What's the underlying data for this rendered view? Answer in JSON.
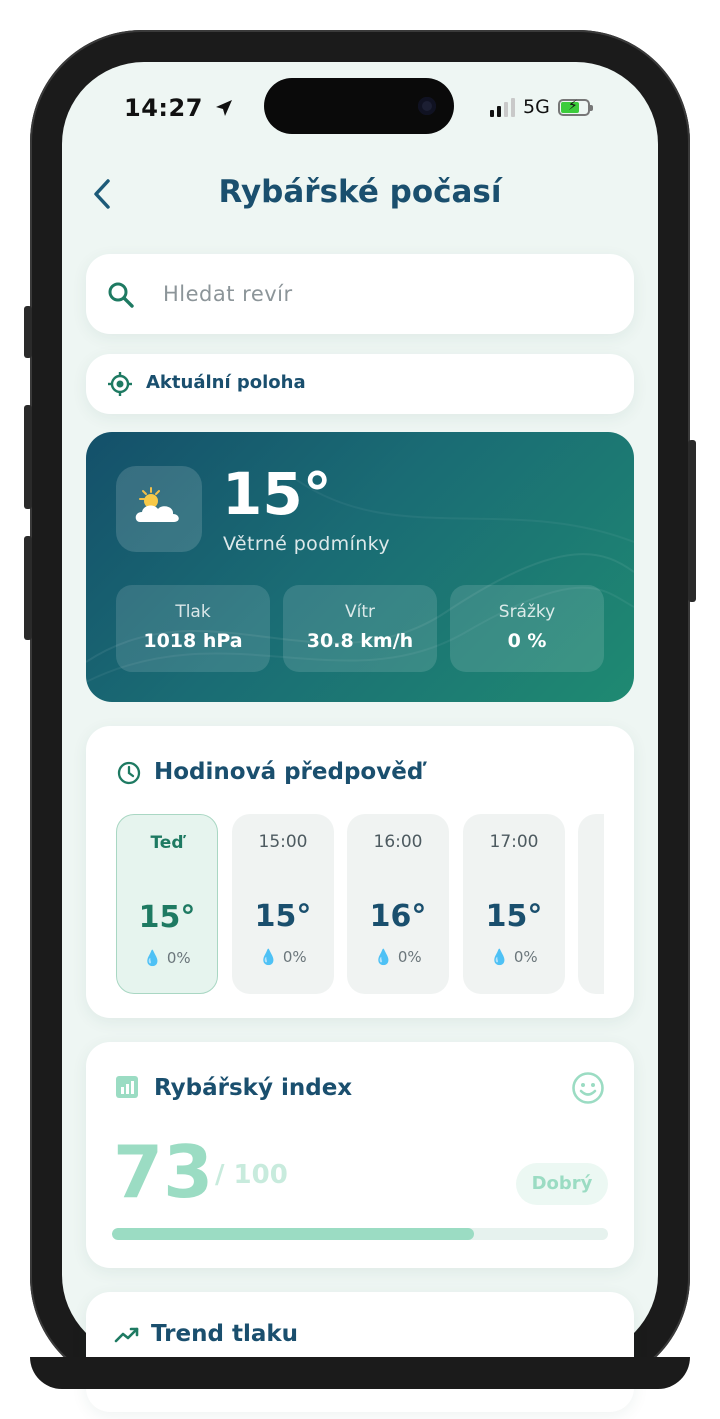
{
  "status_bar": {
    "time": "14:27",
    "network": "5G"
  },
  "header": {
    "back_label": "‹",
    "title": "Rybářské počasí"
  },
  "search": {
    "placeholder": "Hledat revír"
  },
  "location": {
    "label": "Aktuální poloha"
  },
  "current": {
    "icon": "partly-cloudy-icon",
    "temperature": "15°",
    "condition": "Větrné podmínky",
    "stats": [
      {
        "label": "Tlak",
        "value": "1018 hPa"
      },
      {
        "label": "Vítr",
        "value": "30.8 km/h"
      },
      {
        "label": "Srážky",
        "value": "0 %"
      }
    ]
  },
  "hourly": {
    "title": "Hodinová předpověď",
    "items": [
      {
        "time": "Teď",
        "temp": "15°",
        "rain": "0%"
      },
      {
        "time": "15:00",
        "temp": "15°",
        "rain": "0%"
      },
      {
        "time": "16:00",
        "temp": "16°",
        "rain": "0%"
      },
      {
        "time": "17:00",
        "temp": "15°",
        "rain": "0%"
      }
    ]
  },
  "fishing_index": {
    "title": "Rybářský index",
    "value": "73",
    "max": "/ 100",
    "rating": "Dobrý",
    "progress_fraction": 0.73
  },
  "pressure_trend": {
    "title": "Trend tlaku"
  },
  "colors": {
    "primary": "#1a4f6e",
    "accent": "#1e7a62",
    "index": "#9bdcc3",
    "background": "#eef6f3"
  }
}
